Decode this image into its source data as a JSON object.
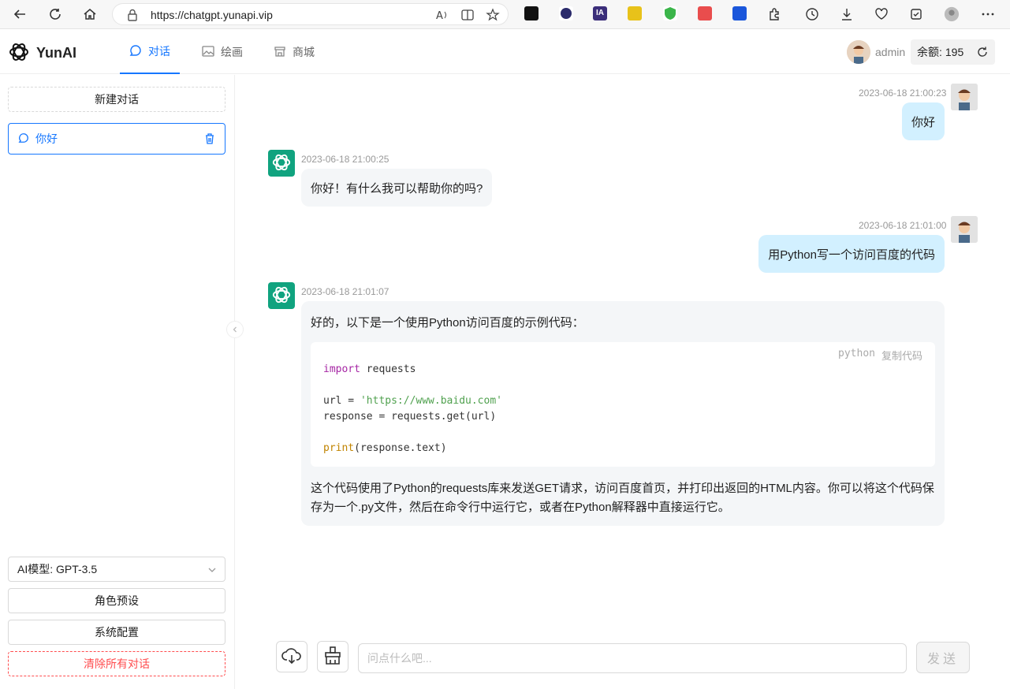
{
  "browser": {
    "url": "https://chatgpt.yunapi.vip",
    "icons": [
      "back-icon",
      "refresh-icon",
      "home-icon",
      "lock-icon",
      "read-aloud-icon",
      "split-screen-icon",
      "favorite-icon",
      "extension-icon",
      "history-icon",
      "download-icon",
      "performance-icon",
      "collections-icon",
      "profile-icon",
      "more-icon"
    ]
  },
  "header": {
    "logo_text": "YunAI",
    "tabs": [
      {
        "label": "对话",
        "active": true
      },
      {
        "label": "绘画",
        "active": false
      },
      {
        "label": "商城",
        "active": false
      }
    ],
    "username": "admin",
    "balance_label": "余额:",
    "balance_value": "195"
  },
  "sidebar": {
    "new_chat": "新建对话",
    "conversations": [
      {
        "title": "你好"
      }
    ],
    "model_select": "AI模型: GPT-3.5",
    "role_preset": "角色预设",
    "system_config": "系统配置",
    "clear_all": "清除所有对话"
  },
  "messages": [
    {
      "role": "user",
      "time": "2023-06-18 21:00:23",
      "text": "你好"
    },
    {
      "role": "assistant",
      "time": "2023-06-18 21:00:25",
      "text": "你好！有什么我可以帮助你的吗?"
    },
    {
      "role": "user",
      "time": "2023-06-18 21:01:00",
      "text": "用Python写一个访问百度的代码"
    },
    {
      "role": "assistant",
      "time": "2023-06-18 21:01:07",
      "intro": "好的，以下是一个使用Python访问百度的示例代码：",
      "code_lang": "python",
      "copy_label": "复制代码",
      "code_lines": {
        "l1_kw": "import",
        "l1_rest": " requests",
        "l3_pre": "url = ",
        "l3_str": "'https://www.baidu.com'",
        "l4": "response = requests.get(url)",
        "l6_fn": "print",
        "l6_rest": "(response.text)"
      },
      "outro": "这个代码使用了Python的requests库来发送GET请求，访问百度首页，并打印出返回的HTML内容。你可以将这个代码保存为一个.py文件，然后在命令行中运行它，或者在Python解释器中直接运行它。"
    }
  ],
  "input": {
    "placeholder": "问点什么吧...",
    "value": "",
    "send_label": "发送"
  },
  "colors": {
    "accent": "#1677ff",
    "bot": "#10a37f",
    "user_bubble": "#d2f0ff",
    "danger": "#ff4d4f"
  }
}
